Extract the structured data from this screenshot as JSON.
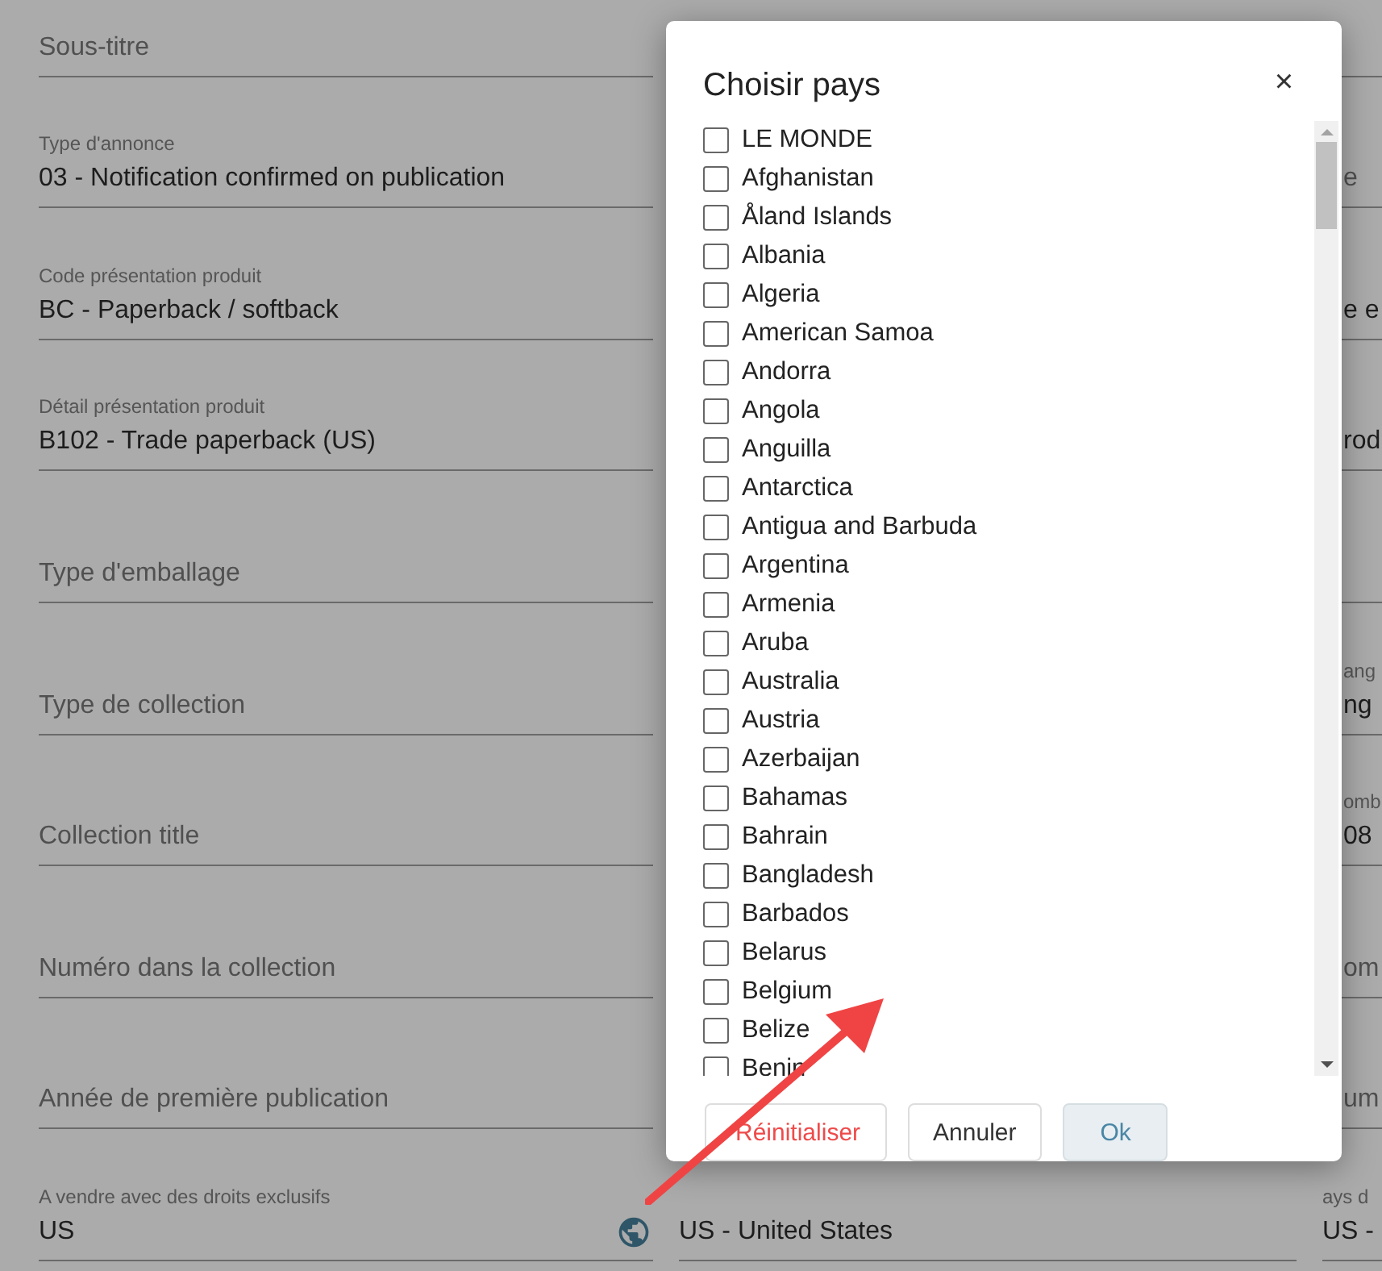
{
  "form": {
    "rows": [
      {
        "left": {
          "placeholder": "Sous-titre"
        },
        "right": {}
      },
      {
        "left": {
          "label": "Type d'annonce",
          "value": "03 - Notification confirmed on publication"
        },
        "right": {
          "placeholder": "e"
        }
      },
      {
        "left": {
          "label": "Code présentation produit",
          "value": "BC - Paperback / softback"
        },
        "right": {
          "value": "e e"
        }
      },
      {
        "left": {
          "label": "Détail présentation produit",
          "value": "B102 - Trade paperback (US)"
        },
        "right": {
          "value": "rod"
        }
      },
      {
        "left": {
          "placeholder": "Type d'emballage"
        },
        "right": {}
      },
      {
        "left": {
          "placeholder": "Type de collection"
        },
        "right": {
          "label": "ang",
          "value": "ng"
        }
      },
      {
        "left": {
          "placeholder": "Collection title"
        },
        "right": {
          "label": "omb",
          "value": "08"
        }
      },
      {
        "left": {
          "placeholder": "Numéro dans la collection"
        },
        "right": {
          "placeholder": "om"
        }
      },
      {
        "left": {
          "placeholder": "Année de première publication"
        },
        "right": {
          "placeholder": "um"
        }
      },
      {
        "left": {
          "kind": "country",
          "label": "A vendre avec des droits exclusifs",
          "value": "US"
        },
        "middle": {
          "value": "US - United States"
        },
        "right": {
          "label": "ays d",
          "value": "US -"
        }
      }
    ]
  },
  "dialog": {
    "title": "Choisir pays",
    "close": "×",
    "items": [
      {
        "label": "LE MONDE",
        "checked": false
      },
      {
        "label": "Afghanistan",
        "checked": false
      },
      {
        "label": "Åland Islands",
        "checked": false
      },
      {
        "label": "Albania",
        "checked": false
      },
      {
        "label": "Algeria",
        "checked": false
      },
      {
        "label": "American Samoa",
        "checked": false
      },
      {
        "label": "Andorra",
        "checked": false
      },
      {
        "label": "Angola",
        "checked": false
      },
      {
        "label": "Anguilla",
        "checked": false
      },
      {
        "label": "Antarctica",
        "checked": false
      },
      {
        "label": "Antigua and Barbuda",
        "checked": false
      },
      {
        "label": "Argentina",
        "checked": false
      },
      {
        "label": "Armenia",
        "checked": false
      },
      {
        "label": "Aruba",
        "checked": false
      },
      {
        "label": "Australia",
        "checked": false
      },
      {
        "label": "Austria",
        "checked": false
      },
      {
        "label": "Azerbaijan",
        "checked": false
      },
      {
        "label": "Bahamas",
        "checked": false
      },
      {
        "label": "Bahrain",
        "checked": false
      },
      {
        "label": "Bangladesh",
        "checked": false
      },
      {
        "label": "Barbados",
        "checked": false
      },
      {
        "label": "Belarus",
        "checked": false
      },
      {
        "label": "Belgium",
        "checked": false
      },
      {
        "label": "Belize",
        "checked": false
      },
      {
        "label": "Benin",
        "checked": false
      }
    ],
    "buttons": [
      {
        "label": "Réinitialiser",
        "kind": "reset"
      },
      {
        "label": "Annuler",
        "kind": "cancel"
      },
      {
        "label": "Ok",
        "kind": "primary"
      }
    ]
  }
}
